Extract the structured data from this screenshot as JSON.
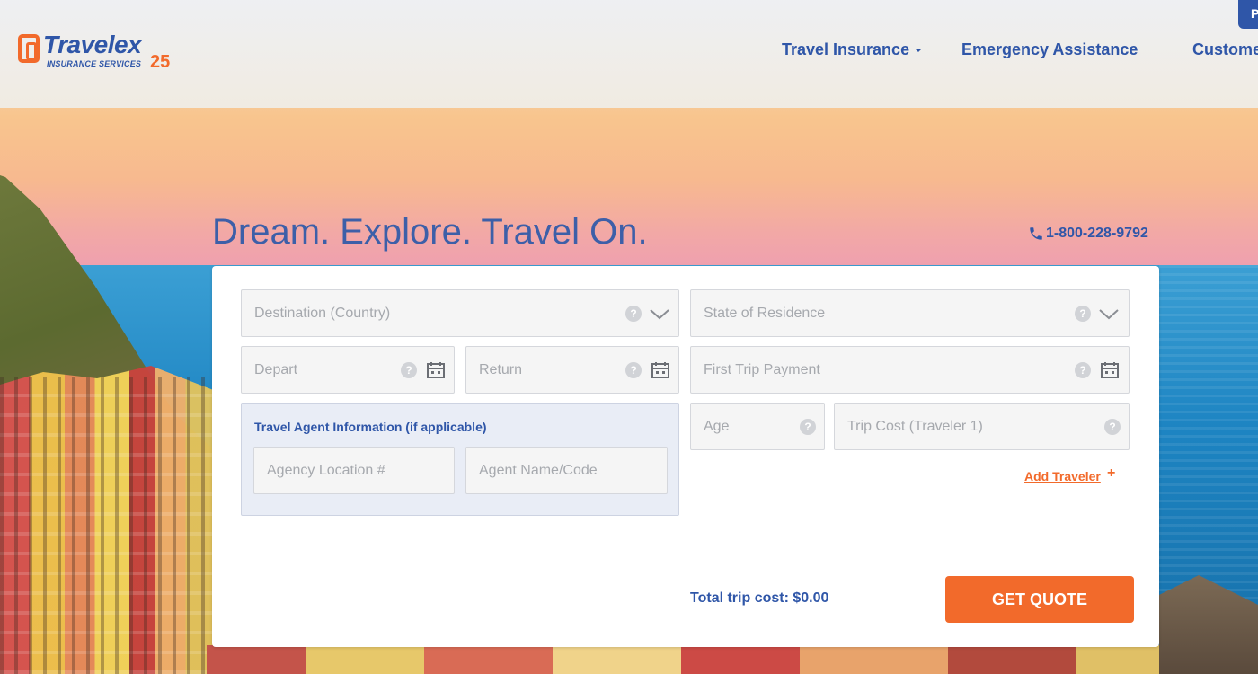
{
  "brand": {
    "name": "Travelex",
    "sub": "INSURANCE SERVICES",
    "badge": "25",
    "orange": "#f26a2b",
    "blue": "#2f56a8"
  },
  "nav": {
    "items": [
      {
        "label": "Travel Insurance",
        "has_dropdown": true
      },
      {
        "label": "Emergency Assistance",
        "has_dropdown": false
      },
      {
        "label": "Custome",
        "has_dropdown": false
      }
    ],
    "corner_button": "P"
  },
  "hero": {
    "title": "Dream. Explore. Travel On.",
    "phone": "1-800-228-9792"
  },
  "form": {
    "destination": {
      "placeholder": "Destination (Country)"
    },
    "state": {
      "placeholder": "State of Residence"
    },
    "depart": {
      "placeholder": "Depart"
    },
    "return": {
      "placeholder": "Return"
    },
    "first_payment": {
      "placeholder": "First Trip Payment"
    },
    "agent": {
      "title": "Travel Agent Information (if applicable)",
      "location_placeholder": "Agency Location #",
      "name_placeholder": "Agent Name/Code"
    },
    "age": {
      "placeholder": "Age"
    },
    "trip_cost": {
      "placeholder": "Trip Cost (Traveler 1)"
    },
    "add_traveler": "Add Traveler",
    "add_plus": "+",
    "help_glyph": "?",
    "total_label": "Total trip cost: $0.00",
    "submit": "GET QUOTE"
  }
}
